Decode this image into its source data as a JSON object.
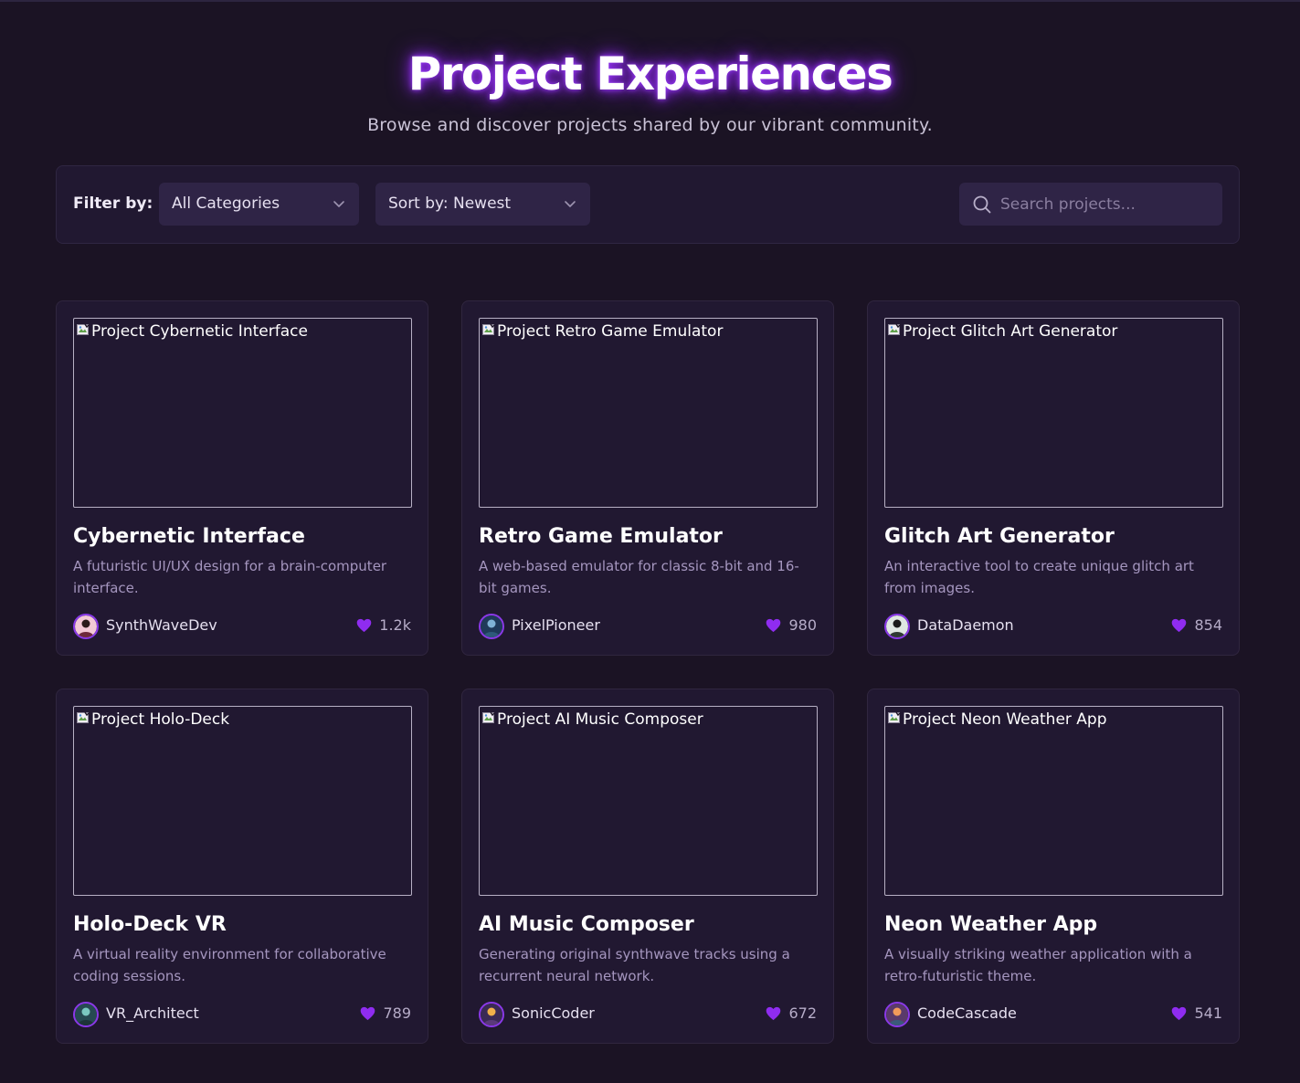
{
  "page": {
    "title": "Project Experiences",
    "subtitle": "Browse and discover projects shared by our vibrant community."
  },
  "filters": {
    "label": "Filter by:",
    "category": "All Categories",
    "sort": "Sort by: Newest",
    "search_placeholder": "Search projects..."
  },
  "colors": {
    "background": "#1b1324",
    "card": "#211831",
    "accent": "#8a2be2",
    "heart": "#8f2cf0"
  },
  "projects": [
    {
      "image_alt": "Project Cybernetic Interface",
      "title": "Cybernetic Interface",
      "description": "A futuristic UI/UX design for a brain-computer interface.",
      "author": "SynthWaveDev",
      "likes": "1.2k",
      "avatar_icon": "woman-portrait-icon"
    },
    {
      "image_alt": "Project Retro Game Emulator",
      "title": "Retro Game Emulator",
      "description": "A web-based emulator for classic 8-bit and 16-bit games.",
      "author": "PixelPioneer",
      "likes": "980",
      "avatar_icon": "robot-head-icon"
    },
    {
      "image_alt": "Project Glitch Art Generator",
      "title": "Glitch Art Generator",
      "description": "An interactive tool to create unique glitch art from images.",
      "author": "DataDaemon",
      "likes": "854",
      "avatar_icon": "dark-figure-icon"
    },
    {
      "image_alt": "Project Holo-Deck",
      "title": "Holo-Deck VR",
      "description": "A virtual reality environment for collaborative coding sessions.",
      "author": "VR_Architect",
      "likes": "789",
      "avatar_icon": "vr-figure-icon"
    },
    {
      "image_alt": "Project AI Music Composer",
      "title": "AI Music Composer",
      "description": "Generating original synthwave tracks using a recurrent neural network.",
      "author": "SonicCoder",
      "likes": "672",
      "avatar_icon": "sunset-icon"
    },
    {
      "image_alt": "Project Neon Weather App",
      "title": "Neon Weather App",
      "description": "A visually striking weather application with a retro-futuristic theme.",
      "author": "CodeCascade",
      "likes": "541",
      "avatar_icon": "landscape-icon"
    }
  ]
}
